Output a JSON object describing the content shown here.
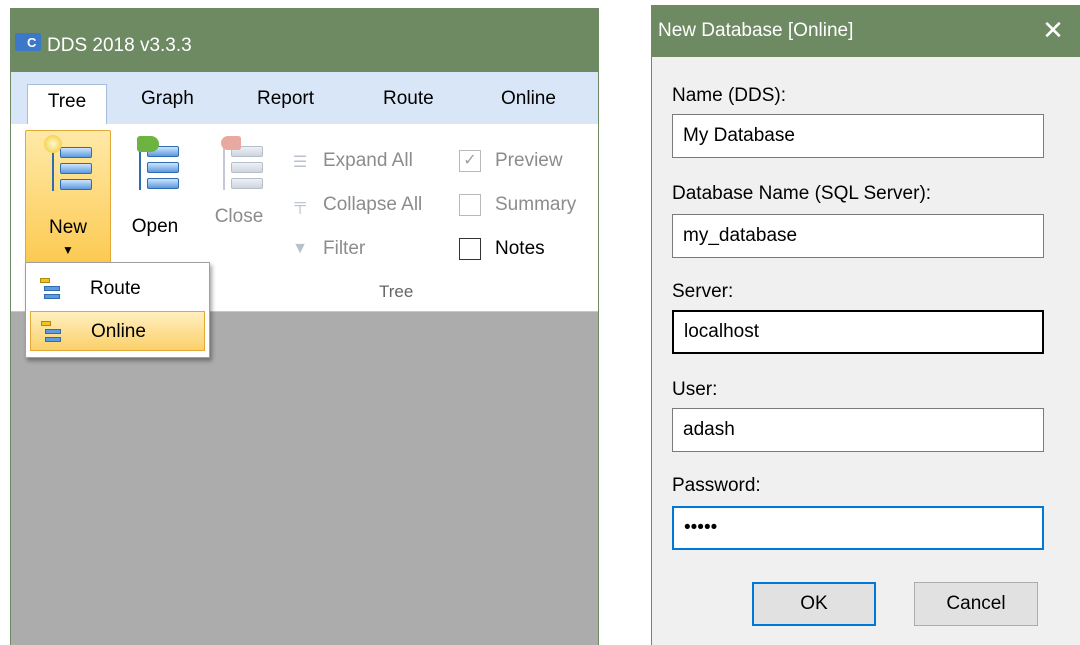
{
  "app": {
    "logo_text": "C",
    "title": "DDS 2018 v3.3.3",
    "tabs": [
      "Tree",
      "Graph",
      "Report",
      "Route",
      "Online"
    ],
    "ribbon": {
      "new_label": "New",
      "new_caret": "▼",
      "open_label": "Open",
      "close_label": "Close",
      "expand_all": "Expand All",
      "collapse_all": "Collapse All",
      "filter": "Filter",
      "preview": "Preview",
      "preview_checked": true,
      "summary": "Summary",
      "summary_checked": false,
      "notes": "Notes",
      "notes_checked": false,
      "group_label": "Tree"
    },
    "new_menu": {
      "items": [
        "Route",
        "Online"
      ],
      "highlighted": "Online"
    }
  },
  "dialog": {
    "title": "New Database [Online]",
    "close_glyph": "✕",
    "name_label": "Name (DDS):",
    "name_value": "My Database",
    "dbname_label": "Database Name (SQL Server):",
    "dbname_value": "my_database",
    "server_label": "Server:",
    "server_value": "localhost",
    "user_label": "User:",
    "user_value": "adash",
    "password_label": "Password:",
    "password_value": "adash",
    "ok_label": "OK",
    "cancel_label": "Cancel"
  },
  "colors": {
    "title_bar": "#6e8a63",
    "tab_strip": "#d8e6f7",
    "highlight": "#fbd06a",
    "focus_blue": "#0078d7",
    "workspace": "#acacac"
  }
}
